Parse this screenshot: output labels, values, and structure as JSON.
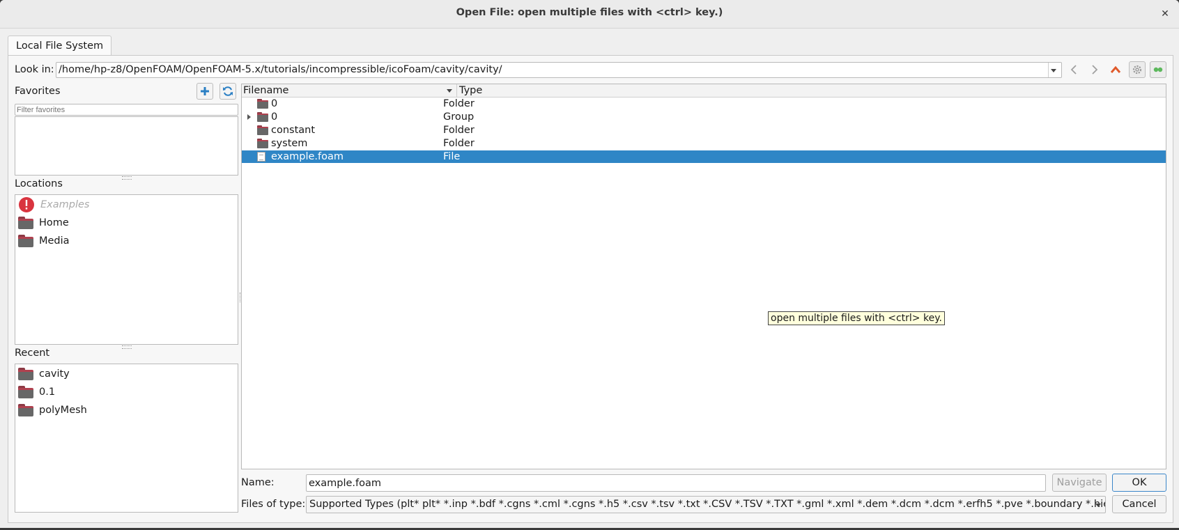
{
  "window": {
    "title": "Open File:  open multiple files with <ctrl> key.)",
    "close_glyph": "✕"
  },
  "tabs": [
    {
      "label": "Local File System"
    }
  ],
  "look_in": {
    "label": "Look in:",
    "path": "/home/hp-z8/OpenFOAM/OpenFOAM-5.x/tutorials/incompressible/icoFoam/cavity/cavity/"
  },
  "nav_icons": [
    "back-icon",
    "forward-icon",
    "parent-directory-icon",
    "settings-icon",
    "toggle-hidden-icon"
  ],
  "favorites": {
    "label": "Favorites",
    "filter_placeholder": "Filter favorites"
  },
  "locations": {
    "label": "Locations",
    "items": [
      {
        "label": "Examples",
        "icon": "error-icon",
        "disabled": true
      },
      {
        "label": "Home",
        "icon": "folder-icon"
      },
      {
        "label": "Media",
        "icon": "folder-icon"
      }
    ]
  },
  "recent": {
    "label": "Recent",
    "items": [
      {
        "label": "cavity",
        "icon": "folder-icon"
      },
      {
        "label": "0.1",
        "icon": "folder-icon"
      },
      {
        "label": "polyMesh",
        "icon": "folder-icon"
      }
    ]
  },
  "file_list": {
    "columns": [
      "Filename",
      "Type"
    ],
    "rows": [
      {
        "name": "0",
        "type": "Folder",
        "icon": "folder-icon"
      },
      {
        "name": "0",
        "type": "Group",
        "icon": "folder-icon",
        "expandable": true
      },
      {
        "name": "constant",
        "type": "Folder",
        "icon": "folder-icon"
      },
      {
        "name": "system",
        "type": "Folder",
        "icon": "folder-icon"
      },
      {
        "name": "example.foam",
        "type": "File",
        "icon": "file-icon",
        "selected": true
      }
    ]
  },
  "tooltip": "open multiple files with <ctrl> key.",
  "name_field": {
    "label": "Name:",
    "value": "example.foam"
  },
  "files_of_type": {
    "label": "Files of type:",
    "value": "Supported Types (plt* plt* *.inp *.bdf *.cgns *.cml *.cgns *.h5 *.csv *.tsv *.txt *.CSV *.TSV *.TXT *.gml *.xml *.dem *.dcm *.dcm *.erfh5 *.pve *.boundary *.hierarchy *.bc"
  },
  "buttons": {
    "navigate": "Navigate",
    "ok": "OK",
    "cancel": "Cancel"
  },
  "colors": {
    "selection": "#2f86c6",
    "up_arrow": "#e05a2b",
    "add_favorite": "#2a7fc4",
    "error_badge": "#d9343f",
    "folder_tab": "#b0414f"
  }
}
